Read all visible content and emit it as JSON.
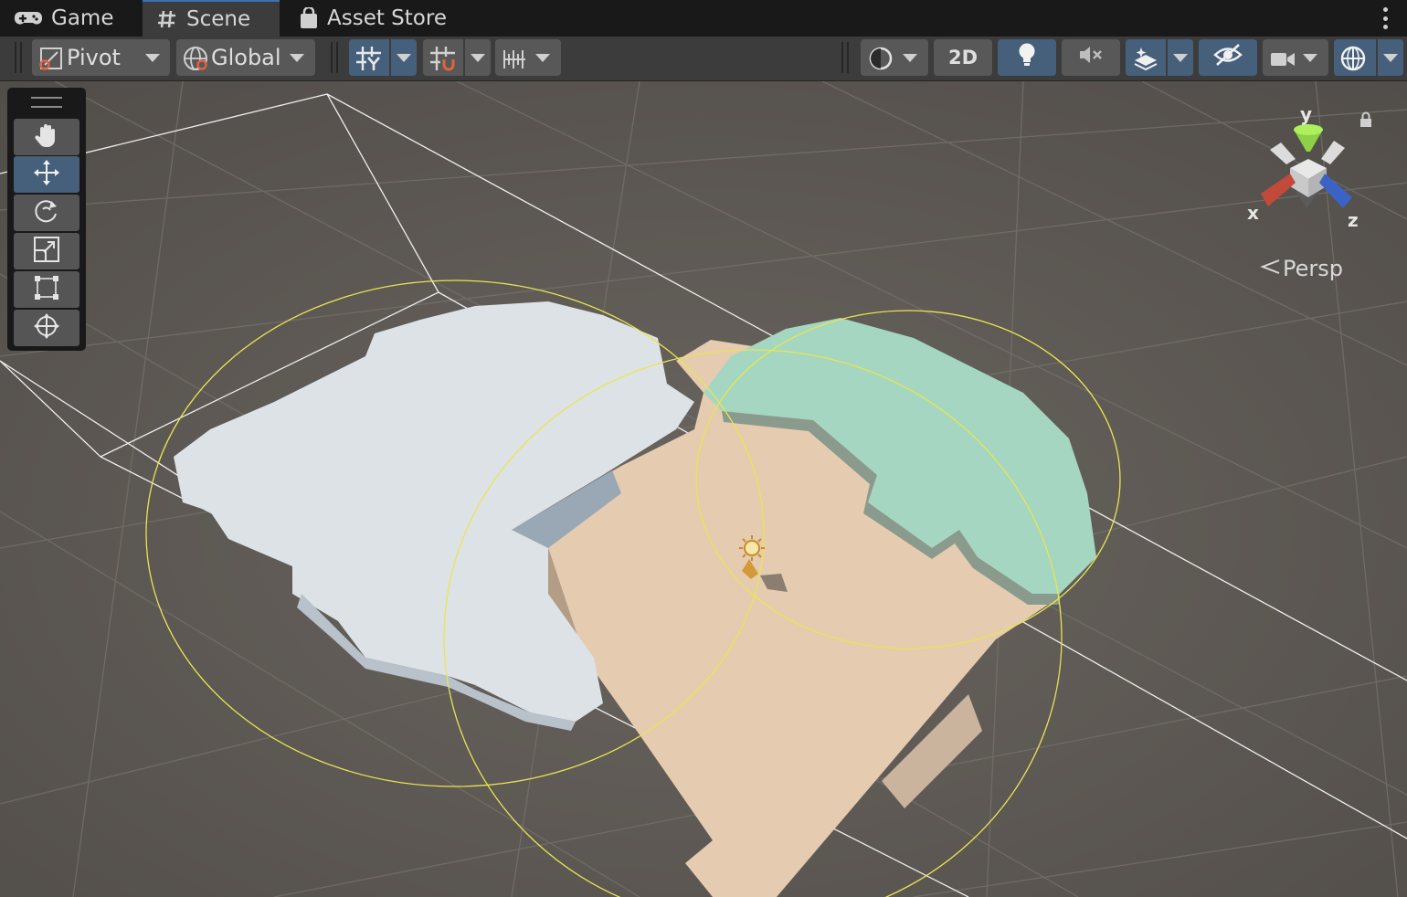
{
  "tabs": [
    {
      "label": "Game",
      "icon": "gamepad-icon",
      "active": false
    },
    {
      "label": "Scene",
      "icon": "hash-icon",
      "active": true
    },
    {
      "label": "Asset Store",
      "icon": "shopping-bag-icon",
      "active": false
    }
  ],
  "toolbar": {
    "pivot_label": "Pivot",
    "global_label": "Global",
    "mode_2d_label": "2D"
  },
  "tools": [
    {
      "name": "hand-tool",
      "icon": "hand-icon",
      "selected": false
    },
    {
      "name": "move-tool",
      "icon": "move-arrows-icon",
      "selected": true
    },
    {
      "name": "rotate-tool",
      "icon": "rotate-icon",
      "selected": false
    },
    {
      "name": "scale-tool",
      "icon": "scale-icon",
      "selected": false
    },
    {
      "name": "rect-tool",
      "icon": "rect-transform-icon",
      "selected": false
    },
    {
      "name": "transform-tool",
      "icon": "transform-icon",
      "selected": false
    }
  ],
  "gizmo": {
    "x_label": "x",
    "y_label": "y",
    "z_label": "z",
    "projection_label": "Persp"
  },
  "colors": {
    "accent_blue": "#46607c",
    "viewport_bg": "#5f5a55",
    "ground_beige": "#e5cbb0",
    "snow_white": "#dde2e6",
    "grass_teal": "#a5d6c2",
    "light_range_yellow": "#e8e650"
  }
}
